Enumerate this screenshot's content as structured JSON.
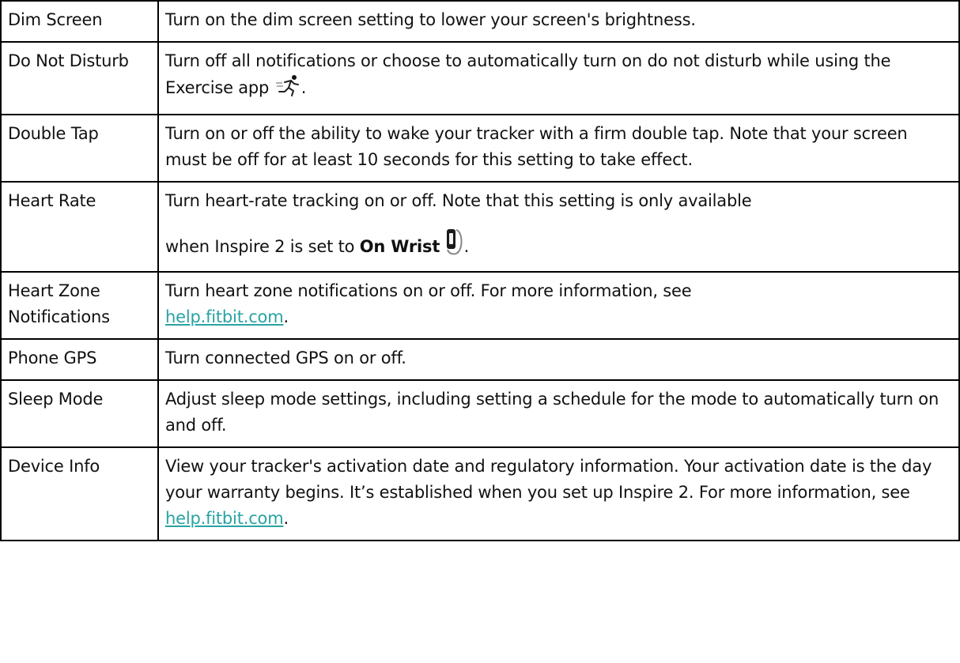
{
  "rows": [
    {
      "name": "Dim Screen",
      "desc": "Turn on the dim screen setting to lower your screen's brightness."
    },
    {
      "name": "Do Not Disturb",
      "desc": "Turn off all notifications or choose to automatically turn on do not disturb while using the Exercise app",
      "desc_end": ".",
      "icon": "running-person-icon"
    },
    {
      "name": "Double Tap",
      "desc": "Turn on or off the ability to wake your tracker with a firm double tap. Note that your screen must be off for at least 10 seconds for this setting to take effect."
    },
    {
      "name": "Heart Rate",
      "desc": "Turn heart-rate tracking on or off. Note that this setting is only available",
      "desc_line2": "when Inspire 2 is set to ",
      "desc_bold": "On Wrist",
      "desc_end": ".",
      "icon": "tracker-on-wrist-icon"
    },
    {
      "name": "Heart Zone Notifications",
      "desc": "Turn heart zone notifications on or off. For more information, see",
      "link": "help.fitbit.com",
      "desc_end": "."
    },
    {
      "name": "Phone GPS",
      "desc": "Turn connected GPS on or off."
    },
    {
      "name": "Sleep Mode",
      "desc": "Adjust sleep mode settings, including setting a schedule for the mode to automatically turn on and off."
    },
    {
      "name": "Device Info",
      "desc": "View your tracker's activation date and regulatory information. Your activation date is the day your warranty begins. It’s established when you set up Inspire 2. For more information, see",
      "link": "help.fitbit.com",
      "desc_end": "."
    }
  ]
}
